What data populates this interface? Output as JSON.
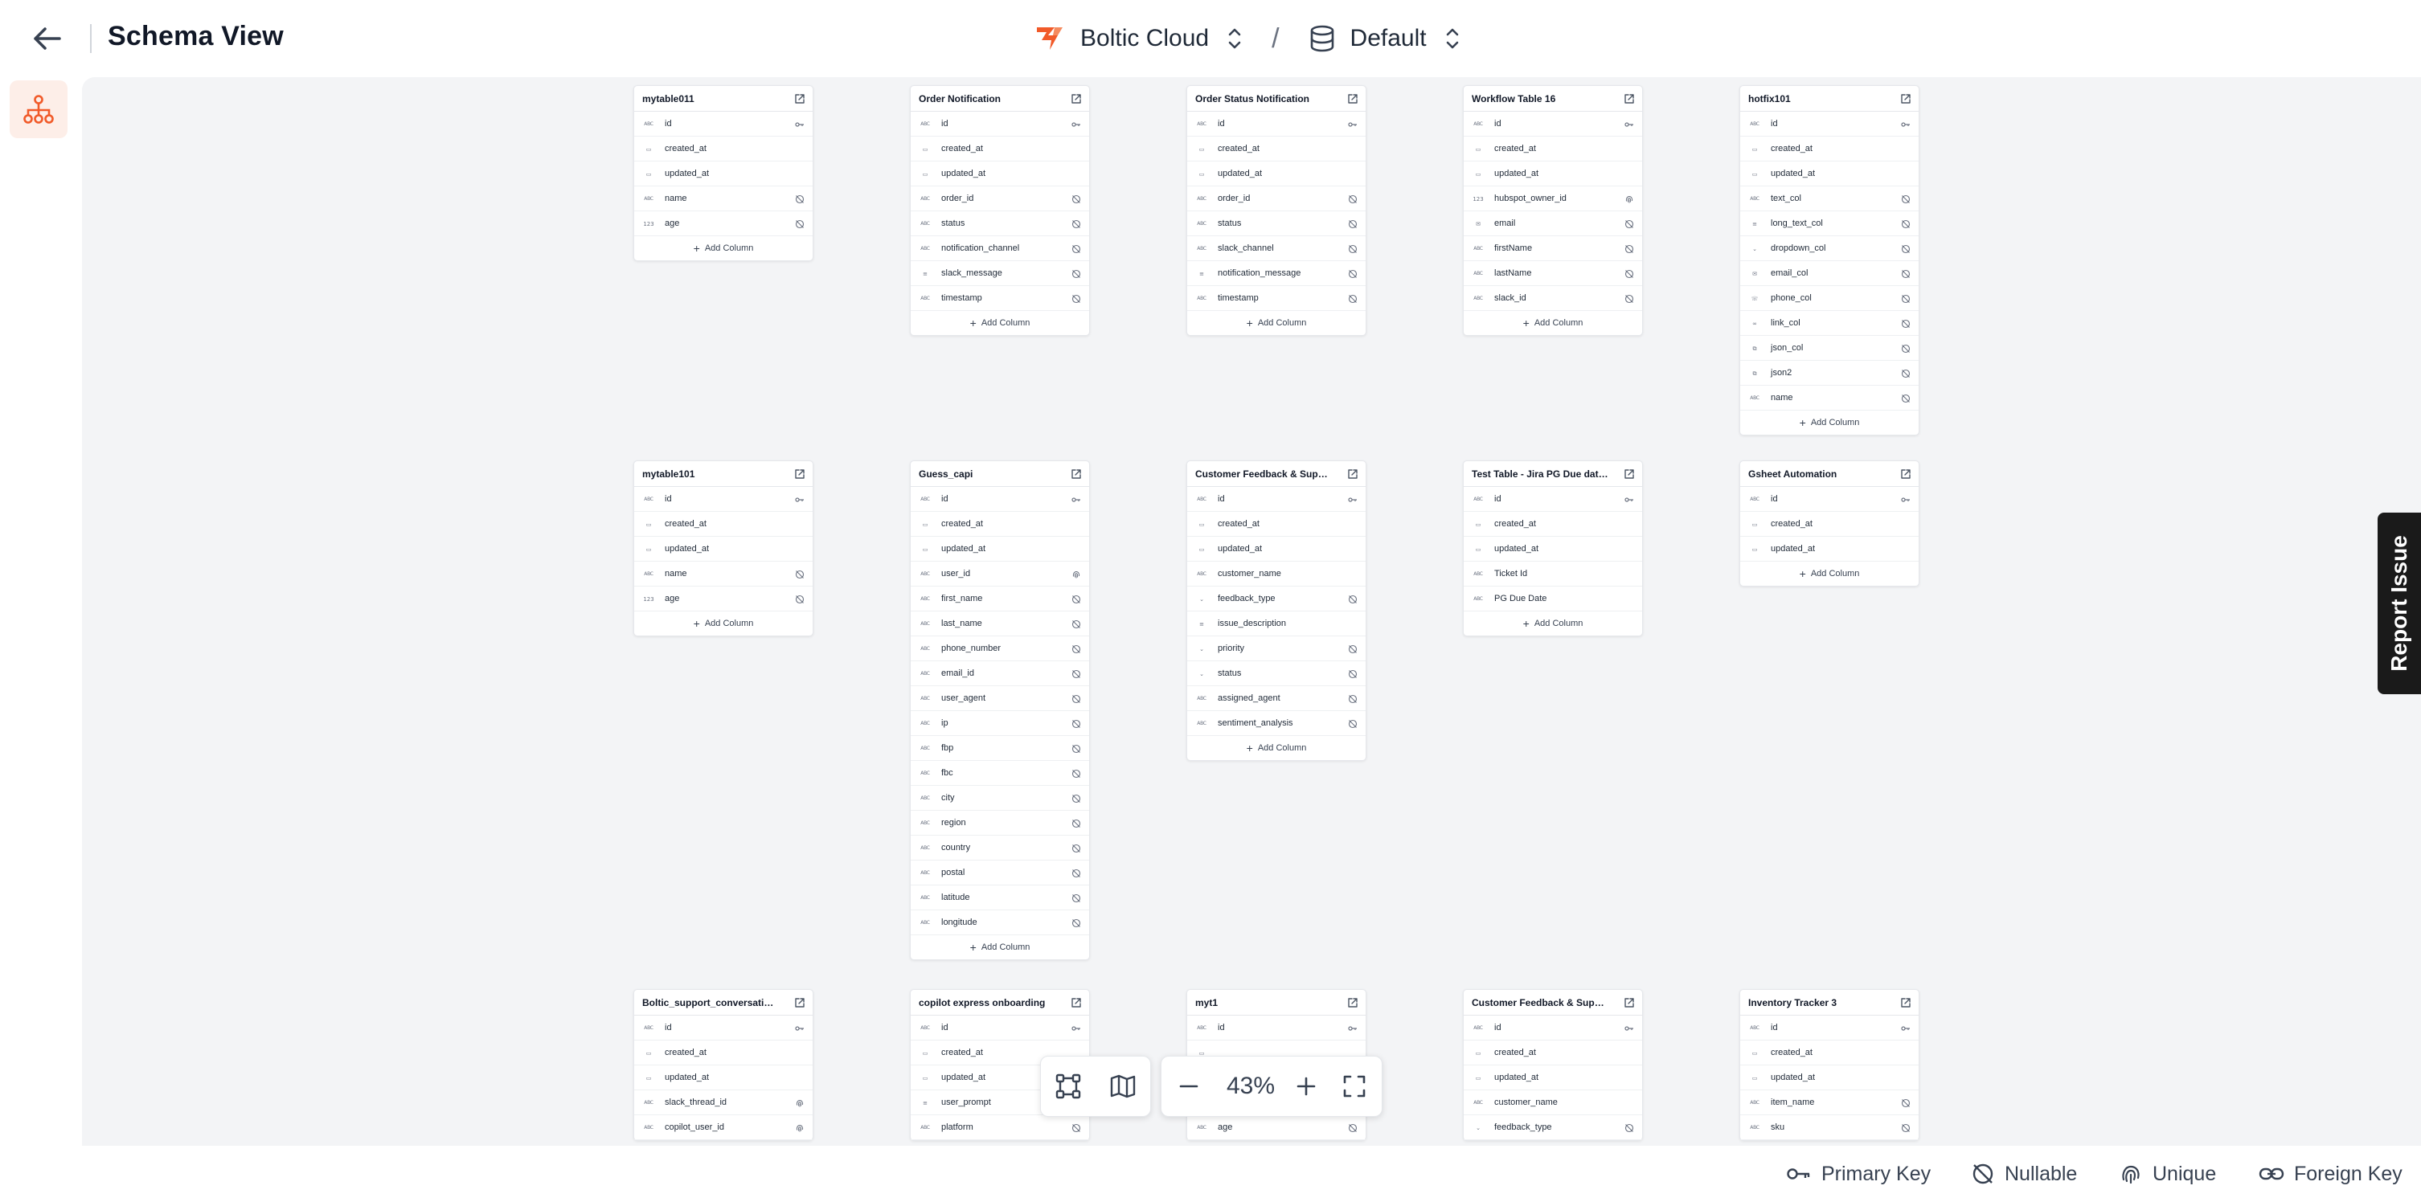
{
  "header": {
    "back_icon": "arrow-left-icon",
    "title": "Schema View",
    "workspace": "Boltic Cloud",
    "separator": "/",
    "database": "Default"
  },
  "rail": {
    "active_icon": "schema-tree-icon"
  },
  "colors": {
    "accent": "#f15a29",
    "canvas": "#f3f4f6"
  },
  "tables": [
    {
      "name": "mytable011",
      "columns": [
        {
          "name": "id",
          "type": "ABC",
          "c": "key"
        },
        {
          "name": "created_at",
          "type": "cal"
        },
        {
          "name": "updated_at",
          "type": "cal"
        },
        {
          "name": "name",
          "type": "ABC",
          "c": "null"
        },
        {
          "name": "age",
          "type": "123",
          "c": "null"
        }
      ],
      "add": "Add Column"
    },
    {
      "name": "Order Notification",
      "columns": [
        {
          "name": "id",
          "type": "ABC",
          "c": "key"
        },
        {
          "name": "created_at",
          "type": "cal"
        },
        {
          "name": "updated_at",
          "type": "cal"
        },
        {
          "name": "order_id",
          "type": "ABC",
          "c": "null"
        },
        {
          "name": "status",
          "type": "ABC",
          "c": "null"
        },
        {
          "name": "notification_channel",
          "type": "ABC",
          "c": "null"
        },
        {
          "name": "slack_message",
          "type": "lines",
          "c": "null"
        },
        {
          "name": "timestamp",
          "type": "ABC",
          "c": "null"
        }
      ],
      "add": "Add Column"
    },
    {
      "name": "Order Status Notification",
      "columns": [
        {
          "name": "id",
          "type": "ABC",
          "c": "key"
        },
        {
          "name": "created_at",
          "type": "cal"
        },
        {
          "name": "updated_at",
          "type": "cal"
        },
        {
          "name": "order_id",
          "type": "ABC",
          "c": "null"
        },
        {
          "name": "status",
          "type": "ABC",
          "c": "null"
        },
        {
          "name": "slack_channel",
          "type": "ABC",
          "c": "null"
        },
        {
          "name": "notification_message",
          "type": "lines",
          "c": "null"
        },
        {
          "name": "timestamp",
          "type": "ABC",
          "c": "null"
        }
      ],
      "add": "Add Column"
    },
    {
      "name": "Workflow Table 16",
      "columns": [
        {
          "name": "id",
          "type": "ABC",
          "c": "key"
        },
        {
          "name": "created_at",
          "type": "cal"
        },
        {
          "name": "updated_at",
          "type": "cal"
        },
        {
          "name": "hubspot_owner_id",
          "type": "123",
          "c": "uniq"
        },
        {
          "name": "email",
          "type": "mail",
          "c": "null"
        },
        {
          "name": "firstName",
          "type": "ABC",
          "c": "null"
        },
        {
          "name": "lastName",
          "type": "ABC",
          "c": "null"
        },
        {
          "name": "slack_id",
          "type": "ABC",
          "c": "null"
        }
      ],
      "add": "Add Column"
    },
    {
      "name": "hotfix101",
      "columns": [
        {
          "name": "id",
          "type": "ABC",
          "c": "key"
        },
        {
          "name": "created_at",
          "type": "cal"
        },
        {
          "name": "updated_at",
          "type": "cal"
        },
        {
          "name": "text_col",
          "type": "ABC",
          "c": "null"
        },
        {
          "name": "long_text_col",
          "type": "lines",
          "c": "null"
        },
        {
          "name": "dropdown_col",
          "type": "chev",
          "c": "null"
        },
        {
          "name": "email_col",
          "type": "mail",
          "c": "null"
        },
        {
          "name": "phone_col",
          "type": "phone",
          "c": "null"
        },
        {
          "name": "link_col",
          "type": "link",
          "c": "null"
        },
        {
          "name": "json_col",
          "type": "json",
          "c": "null"
        },
        {
          "name": "json2",
          "type": "json",
          "c": "null"
        },
        {
          "name": "name",
          "type": "ABC",
          "c": "null"
        }
      ],
      "add": "Add Column"
    },
    {
      "name": "mytable101",
      "columns": [
        {
          "name": "id",
          "type": "ABC",
          "c": "key"
        },
        {
          "name": "created_at",
          "type": "cal"
        },
        {
          "name": "updated_at",
          "type": "cal"
        },
        {
          "name": "name",
          "type": "ABC",
          "c": "null"
        },
        {
          "name": "age",
          "type": "123",
          "c": "null"
        }
      ],
      "add": "Add Column"
    },
    {
      "name": "Guess_capi",
      "columns": [
        {
          "name": "id",
          "type": "ABC",
          "c": "key"
        },
        {
          "name": "created_at",
          "type": "cal"
        },
        {
          "name": "updated_at",
          "type": "cal"
        },
        {
          "name": "user_id",
          "type": "ABC",
          "c": "uniq"
        },
        {
          "name": "first_name",
          "type": "ABC",
          "c": "null"
        },
        {
          "name": "last_name",
          "type": "ABC",
          "c": "null"
        },
        {
          "name": "phone_number",
          "type": "ABC",
          "c": "null"
        },
        {
          "name": "email_id",
          "type": "ABC",
          "c": "null"
        },
        {
          "name": "user_agent",
          "type": "ABC",
          "c": "null"
        },
        {
          "name": "ip",
          "type": "ABC",
          "c": "null"
        },
        {
          "name": "fbp",
          "type": "ABC",
          "c": "null"
        },
        {
          "name": "fbc",
          "type": "ABC",
          "c": "null"
        },
        {
          "name": "city",
          "type": "ABC",
          "c": "null"
        },
        {
          "name": "region",
          "type": "ABC",
          "c": "null"
        },
        {
          "name": "country",
          "type": "ABC",
          "c": "null"
        },
        {
          "name": "postal",
          "type": "ABC",
          "c": "null"
        },
        {
          "name": "latitude",
          "type": "ABC",
          "c": "null"
        },
        {
          "name": "longitude",
          "type": "ABC",
          "c": "null"
        }
      ],
      "add": "Add Column"
    },
    {
      "name": "Customer Feedback & Suppor...",
      "columns": [
        {
          "name": "id",
          "type": "ABC",
          "c": "key"
        },
        {
          "name": "created_at",
          "type": "cal"
        },
        {
          "name": "updated_at",
          "type": "cal"
        },
        {
          "name": "customer_name",
          "type": "ABC"
        },
        {
          "name": "feedback_type",
          "type": "chev",
          "c": "null"
        },
        {
          "name": "issue_description",
          "type": "lines"
        },
        {
          "name": "priority",
          "type": "chev",
          "c": "null"
        },
        {
          "name": "status",
          "type": "chev",
          "c": "null"
        },
        {
          "name": "assigned_agent",
          "type": "ABC",
          "c": "null"
        },
        {
          "name": "sentiment_analysis",
          "type": "ABC",
          "c": "null"
        }
      ],
      "add": "Add Column"
    },
    {
      "name": "Test Table - Jira PG Due date ...",
      "columns": [
        {
          "name": "id",
          "type": "ABC",
          "c": "key"
        },
        {
          "name": "created_at",
          "type": "cal"
        },
        {
          "name": "updated_at",
          "type": "cal"
        },
        {
          "name": "Ticket Id",
          "type": "ABC"
        },
        {
          "name": "PG Due Date",
          "type": "ABC"
        }
      ],
      "add": "Add Column"
    },
    {
      "name": "Gsheet Automation",
      "columns": [
        {
          "name": "id",
          "type": "ABC",
          "c": "key"
        },
        {
          "name": "created_at",
          "type": "cal"
        },
        {
          "name": "updated_at",
          "type": "cal"
        }
      ],
      "add": "Add Column"
    },
    {
      "name": "Boltic_support_conversations",
      "columns": [
        {
          "name": "id",
          "type": "ABC",
          "c": "key"
        },
        {
          "name": "created_at",
          "type": "cal"
        },
        {
          "name": "updated_at",
          "type": "cal"
        },
        {
          "name": "slack_thread_id",
          "type": "ABC",
          "c": "uniq"
        },
        {
          "name": "copilot_user_id",
          "type": "ABC",
          "c": "uniq"
        }
      ],
      "add": ""
    },
    {
      "name": "copilot express onboarding",
      "columns": [
        {
          "name": "id",
          "type": "ABC",
          "c": "key"
        },
        {
          "name": "created_at",
          "type": "cal"
        },
        {
          "name": "updated_at",
          "type": "cal"
        },
        {
          "name": "user_prompt",
          "type": "lines",
          "c": "null"
        },
        {
          "name": "platform",
          "type": "ABC",
          "c": "null"
        }
      ],
      "add": ""
    },
    {
      "name": "myt1",
      "columns": [
        {
          "name": "id",
          "type": "ABC",
          "c": "key"
        },
        {
          "name": "",
          "type": "cal"
        },
        {
          "name": "",
          "type": "cal"
        },
        {
          "name": "",
          "type": "ABC"
        },
        {
          "name": "age",
          "type": "ABC",
          "c": "null"
        }
      ],
      "add": ""
    },
    {
      "name": "Customer Feedback & Suppor...",
      "columns": [
        {
          "name": "id",
          "type": "ABC",
          "c": "key"
        },
        {
          "name": "created_at",
          "type": "cal"
        },
        {
          "name": "updated_at",
          "type": "cal"
        },
        {
          "name": "customer_name",
          "type": "ABC"
        },
        {
          "name": "feedback_type",
          "type": "chev",
          "c": "null"
        }
      ],
      "add": ""
    },
    {
      "name": "Inventory Tracker 3",
      "columns": [
        {
          "name": "id",
          "type": "ABC",
          "c": "key"
        },
        {
          "name": "created_at",
          "type": "cal"
        },
        {
          "name": "updated_at",
          "type": "cal"
        },
        {
          "name": "item_name",
          "type": "ABC",
          "c": "null"
        },
        {
          "name": "sku",
          "type": "ABC",
          "c": "null"
        }
      ],
      "add": ""
    }
  ],
  "toolbar": {
    "fit_icon": "fit-view-icon",
    "minimap_icon": "minimap-icon",
    "zoom_out_icon": "minus-icon",
    "zoom_level": "43%",
    "zoom_in_icon": "plus-icon",
    "fullscreen_icon": "fullscreen-icon"
  },
  "report_issue": "Report Issue",
  "legend": [
    {
      "label": "Primary Key",
      "icon": "key-icon"
    },
    {
      "label": "Nullable",
      "icon": "nullable-icon"
    },
    {
      "label": "Unique",
      "icon": "fingerprint-icon"
    },
    {
      "label": "Foreign Key",
      "icon": "link-icon"
    }
  ]
}
